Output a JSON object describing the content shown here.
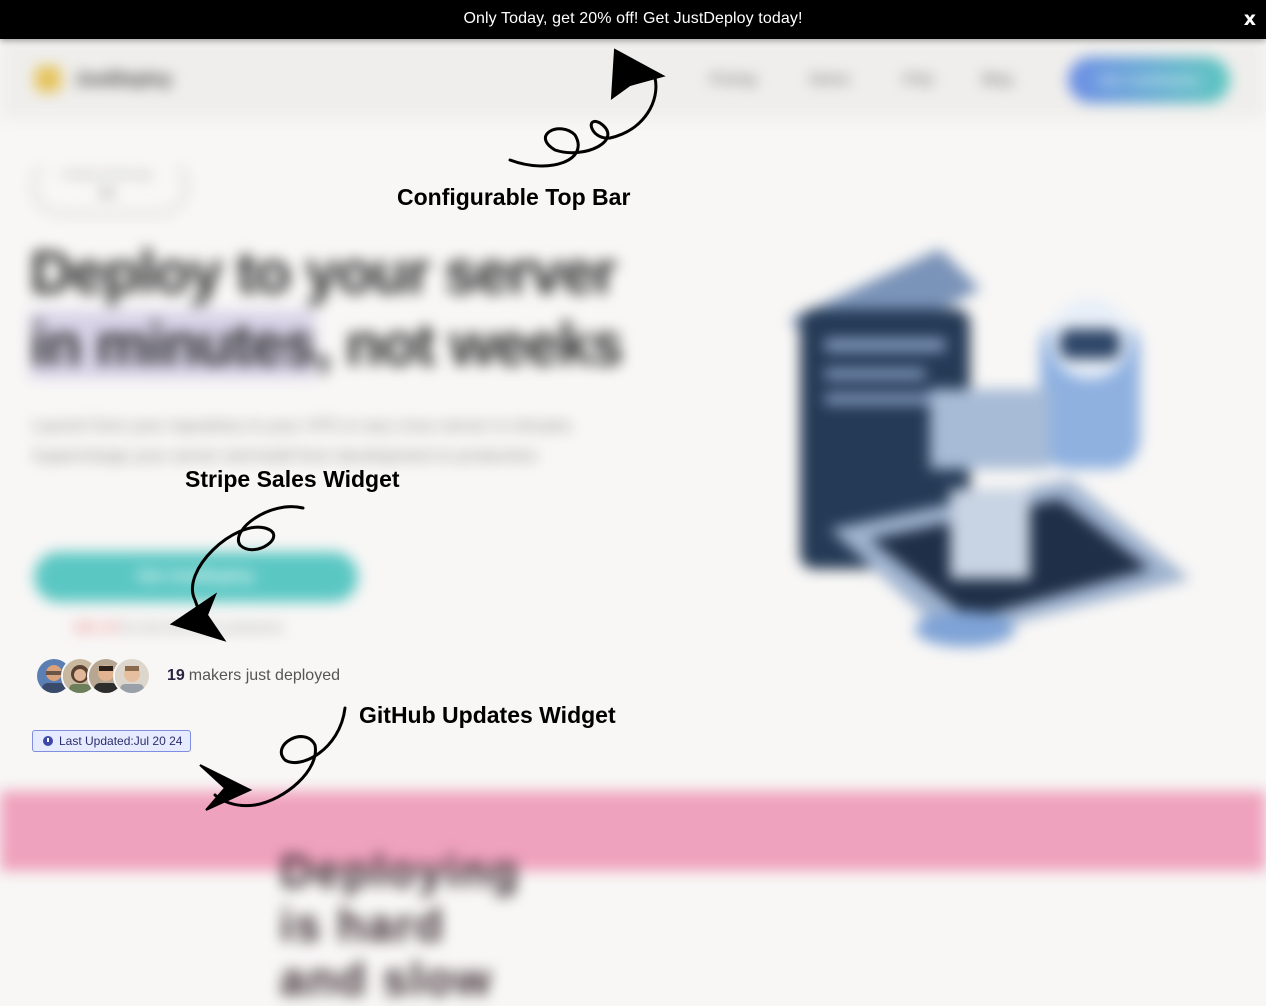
{
  "topbar": {
    "message": "Only Today, get 20% off! Get JustDeploy today!",
    "close_label": "x"
  },
  "site": {
    "logo_text": "JustDeploy",
    "nav_links": [
      "Pricing",
      "Demo",
      "FAQ",
      "Blog"
    ],
    "nav_cta": "Get JustDeploy",
    "badge_top": "Product of the day",
    "badge_bottom": "#1",
    "hero_line1": "Deploy to your server",
    "hero_highlight": "in minutes",
    "hero_line2_rest": ", not weeks",
    "hero_subtitle": "Launch from your repository to your VPS or any Linux server in minutes. Supercharge your server and build from development to production.",
    "hero_cta": "Get JustDeploy",
    "hero_note_red": "$50 off",
    "hero_note_rest": " for the first 500 customers",
    "pink_text": "Deploying is hard and slow"
  },
  "widgets": {
    "makers_count": "19",
    "makers_text": "makers just deployed",
    "last_updated": "Last Updated:Jul 20 24"
  },
  "annotations": {
    "top_bar": "Configurable Top Bar",
    "stripe": "Stripe Sales Widget",
    "github": "GitHub Updates Widget"
  },
  "colors": {
    "topbar_bg": "#000000",
    "page_bg": "#f8f7f6",
    "accent_teal": "#5bc7c3",
    "badge_blue": "#e7ebff",
    "pink_band": "#efa2bd"
  }
}
